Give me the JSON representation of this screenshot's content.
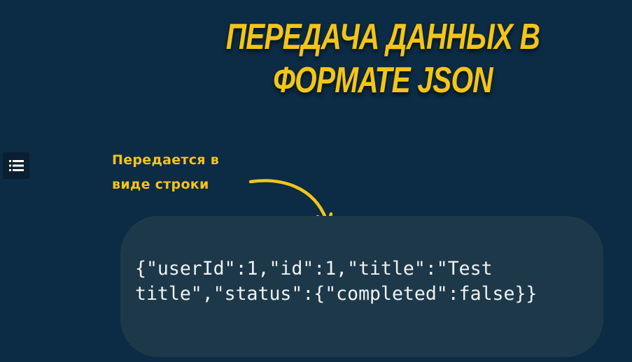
{
  "title": {
    "line1": "ПЕРЕДАЧА ДАННЫХ В",
    "line2": "ФОРМАТЕ JSON"
  },
  "annotation": {
    "line1": "Передается в",
    "line2": "виде строки"
  },
  "code": {
    "line1": "{\"userId\":1,\"id\":1,\"title\":\"Test",
    "line2": "title\",\"status\":{\"completed\":false}}"
  },
  "menu": {
    "icon": "list-menu-icon"
  },
  "colors": {
    "background": "#0c2b44",
    "accent": "#f3c519",
    "code_box": "#1d3949",
    "code_text": "#f0f2f4"
  }
}
